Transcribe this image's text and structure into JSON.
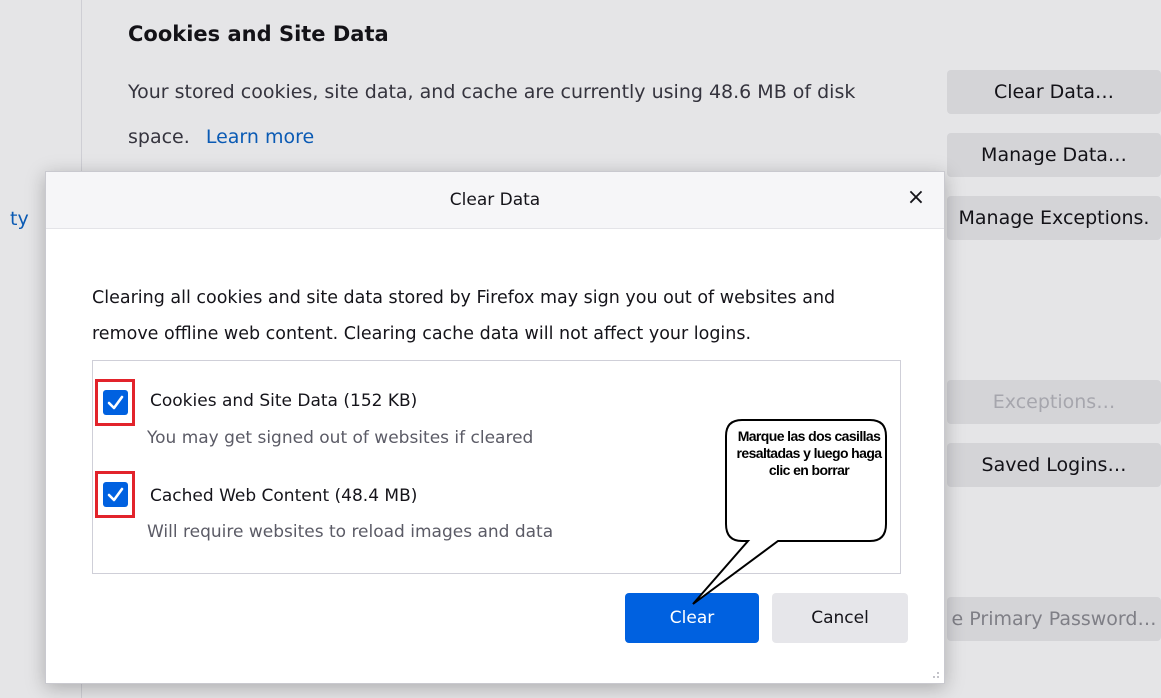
{
  "sidebar": {
    "partial_label": "ty"
  },
  "section": {
    "title": "Cookies and Site Data",
    "description": "Your stored cookies, site data, and cache are currently using 48.6 MB of disk space.",
    "learn_more": "Learn more"
  },
  "side_buttons": {
    "clear_data": "Clear Data…",
    "manage_data": "Manage Data…",
    "manage_exceptions": "Manage Exceptions.",
    "exceptions": "Exceptions…",
    "saved_logins": "Saved Logins…",
    "primary_password": "e Primary Password…"
  },
  "dialog": {
    "title": "Clear Data",
    "close": "×",
    "text": "Clearing all cookies and site data stored by Firefox may sign you out of websites and remove offline web content. Clearing cache data will not affect your logins.",
    "options": [
      {
        "label": "Cookies and Site Data (152 KB)",
        "sub": "You may get signed out of websites if cleared",
        "checked": true
      },
      {
        "label": "Cached Web Content (48.4 MB)",
        "sub": "Will require websites to reload images and data",
        "checked": true
      }
    ],
    "clear_button": "Clear",
    "cancel_button": "Cancel"
  },
  "callout": {
    "text": "Marque las dos casillas resaltadas y luego haga clic en borrar"
  },
  "colors": {
    "accent": "#0061e0",
    "highlight": "#e2232b",
    "link": "#0b62c4"
  }
}
